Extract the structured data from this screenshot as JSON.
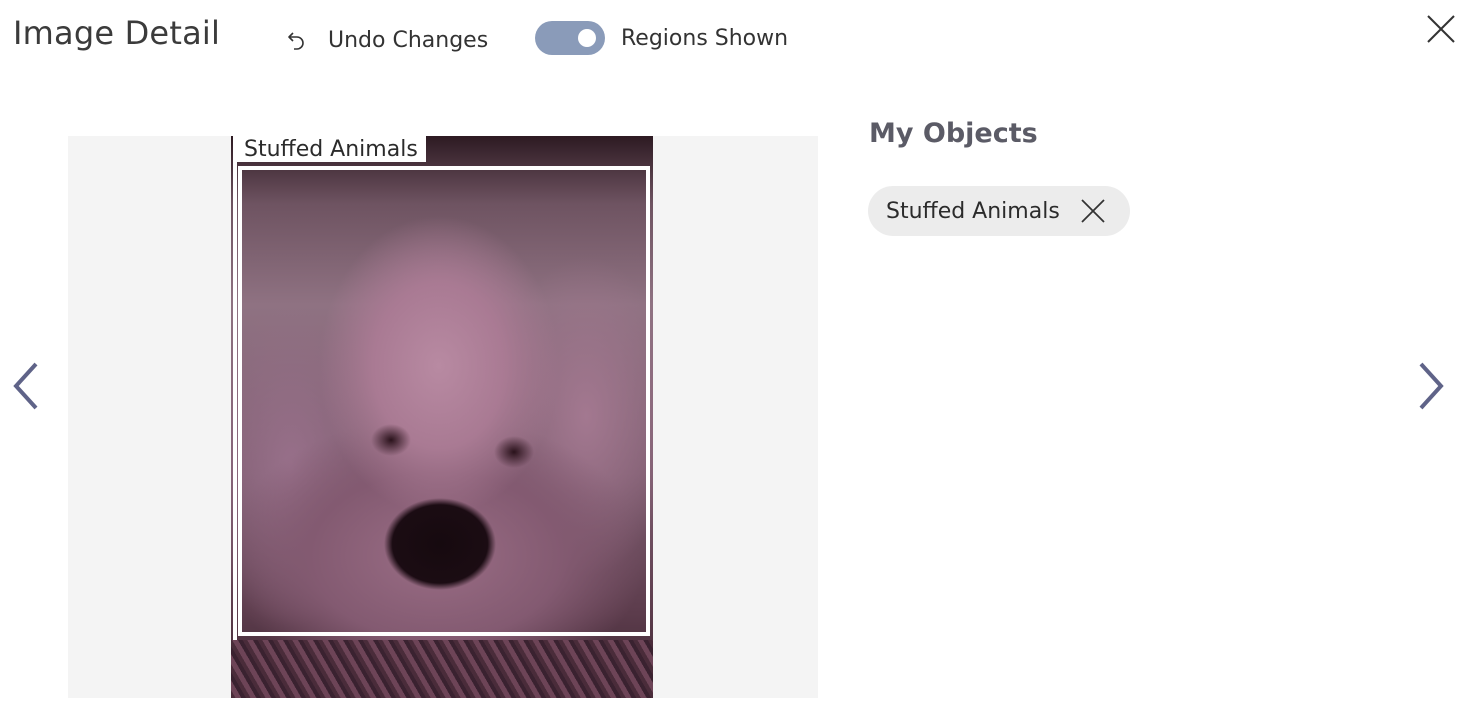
{
  "header": {
    "title": "Image Detail",
    "undo_label": "Undo Changes",
    "undo_icon": "undo-icon",
    "toggle_label": "Regions Shown",
    "toggle_on": true,
    "close_icon": "close-icon"
  },
  "image": {
    "region_label": "Stuffed Animals"
  },
  "navigation": {
    "prev_icon": "chevron-left-icon",
    "next_icon": "chevron-right-icon"
  },
  "objects_panel": {
    "title": "My Objects",
    "chips": [
      {
        "label": "Stuffed Animals",
        "remove_icon": "close-icon"
      }
    ]
  },
  "colors": {
    "toggle_track": "#8a9bb9",
    "nav_arrow": "#5f6388",
    "chip_background": "#ececec"
  }
}
